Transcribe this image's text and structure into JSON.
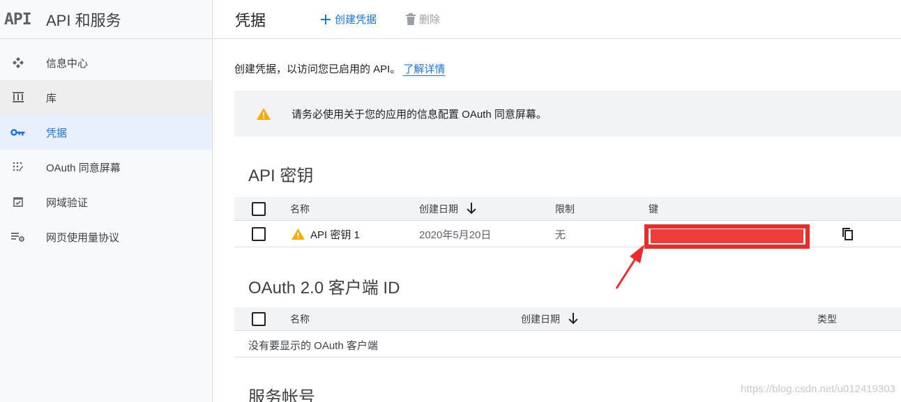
{
  "sidebar": {
    "logo": "API",
    "title": "API 和服务",
    "items": [
      {
        "label": "信息中心",
        "icon": "dashboard-icon"
      },
      {
        "label": "库",
        "icon": "library-icon"
      },
      {
        "label": "凭据",
        "icon": "key-icon"
      },
      {
        "label": "OAuth 同意屏幕",
        "icon": "consent-screen-icon"
      },
      {
        "label": "网域验证",
        "icon": "domain-verification-icon"
      },
      {
        "label": "网页使用量协议",
        "icon": "settings-list-icon"
      }
    ]
  },
  "header": {
    "title": "凭据",
    "create_label": "创建凭据",
    "delete_label": "删除"
  },
  "intro": {
    "text": "创建凭据，以访问您已启用的 API。",
    "link": "了解详情"
  },
  "alert": {
    "text": "请务必使用关于您的应用的信息配置 OAuth 同意屏幕。"
  },
  "api_keys": {
    "title": "API 密钥",
    "columns": {
      "name": "名称",
      "created": "创建日期",
      "restriction": "限制",
      "key": "键"
    },
    "rows": [
      {
        "name": "API 密钥 1",
        "created": "2020年5月20日",
        "restriction": "无"
      }
    ]
  },
  "oauth": {
    "title": "OAuth 2.0 客户端 ID",
    "columns": {
      "name": "名称",
      "created": "创建日期",
      "type": "类型"
    },
    "empty": "没有要显示的 OAuth 客户端"
  },
  "service_accounts": {
    "title": "服务帐号"
  },
  "watermark": "https://blog.csdn.net/u012419303",
  "colors": {
    "accent": "#1a73e8",
    "warning": "#f9ab00",
    "highlight": "#ee2b2b",
    "sidebar_bg": "#f8f9fa",
    "active_bg": "#e8f0fe"
  }
}
